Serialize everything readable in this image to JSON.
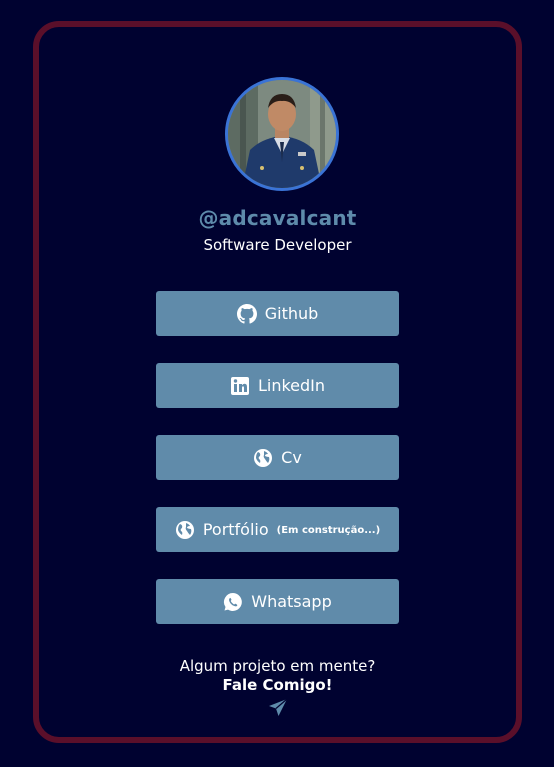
{
  "profile": {
    "handle": "@adcavalcant",
    "role": "Software Developer"
  },
  "links": [
    {
      "label": "Github",
      "icon": "github-icon",
      "note": ""
    },
    {
      "label": "LinkedIn",
      "icon": "linkedin-icon",
      "note": ""
    },
    {
      "label": "Cv",
      "icon": "globe-icon",
      "note": ""
    },
    {
      "label": "Portfólio",
      "icon": "globe-icon",
      "note": "(Em construção...)"
    },
    {
      "label": "Whatsapp",
      "icon": "whatsapp-icon",
      "note": ""
    }
  ],
  "contact": {
    "question": "Algum projeto em mente?",
    "cta": "Fale Comigo!",
    "icon": "paper-plane-icon"
  },
  "colors": {
    "background": "#000230",
    "card_border": "#5a0f2a",
    "button": "#608baa",
    "handle": "#5e8bab",
    "avatar_ring": "#3a73d6"
  }
}
